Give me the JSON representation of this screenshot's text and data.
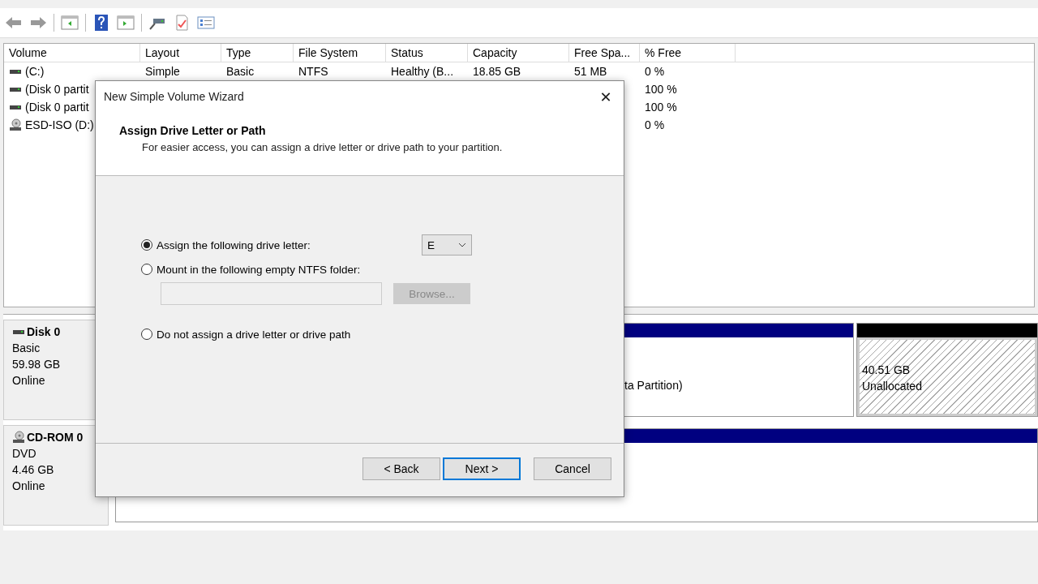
{
  "volume_table": {
    "columns": [
      "Volume",
      "Layout",
      "Type",
      "File System",
      "Status",
      "Capacity",
      "Free Spa...",
      "% Free"
    ],
    "rows": [
      {
        "kind": "drive",
        "volume": "(C:)",
        "layout": "Simple",
        "type": "Basic",
        "file_system": "NTFS",
        "status": "Healthy (B...",
        "capacity": "18.85 GB",
        "free_space": "51 MB",
        "free_percent": "0 %"
      },
      {
        "kind": "drive",
        "volume": "(Disk 0 partit",
        "free_percent": "100 %"
      },
      {
        "kind": "drive",
        "volume": "(Disk 0 partit",
        "free_percent": "100 %"
      },
      {
        "kind": "disc",
        "volume": "ESD-ISO (D:)",
        "free_percent": "0 %"
      }
    ]
  },
  "disks": [
    {
      "kind": "disk",
      "name": "Disk 0",
      "type": "Basic",
      "size": "59.98 GB",
      "status": "Online",
      "partitions": [
        {
          "kind": "primary",
          "lines": [
            "ta Partition)"
          ]
        },
        {
          "kind": "unallocated",
          "lines": [
            "40.51 GB",
            "Unallocated"
          ]
        }
      ]
    },
    {
      "kind": "cdrom",
      "name": "CD-ROM 0",
      "type": "DVD",
      "size": "4.46 GB",
      "status": "Online",
      "partitions": [
        {
          "kind": "primary"
        }
      ]
    }
  ],
  "dialog": {
    "title": "New Simple Volume Wizard",
    "close": "✕",
    "heading": "Assign Drive Letter or Path",
    "subheading": "For easier access, you can assign a drive letter or drive path to your partition.",
    "options": [
      {
        "kind": "letter",
        "label": "Assign the following drive letter:",
        "selected": true
      },
      {
        "kind": "folder",
        "label": "Mount in the following empty NTFS folder:",
        "selected": false
      },
      {
        "kind": "none",
        "label": "Do not assign a drive letter or drive path",
        "selected": false
      }
    ],
    "drive_letter": "E",
    "folder_field": {
      "disabled": true
    },
    "browse_button": {
      "label": "Browse...",
      "disabled": true
    },
    "buttons": [
      {
        "label": "< Back",
        "default": false
      },
      {
        "label": "Next >",
        "default": true
      },
      {
        "label": "Cancel",
        "default": false
      }
    ]
  }
}
